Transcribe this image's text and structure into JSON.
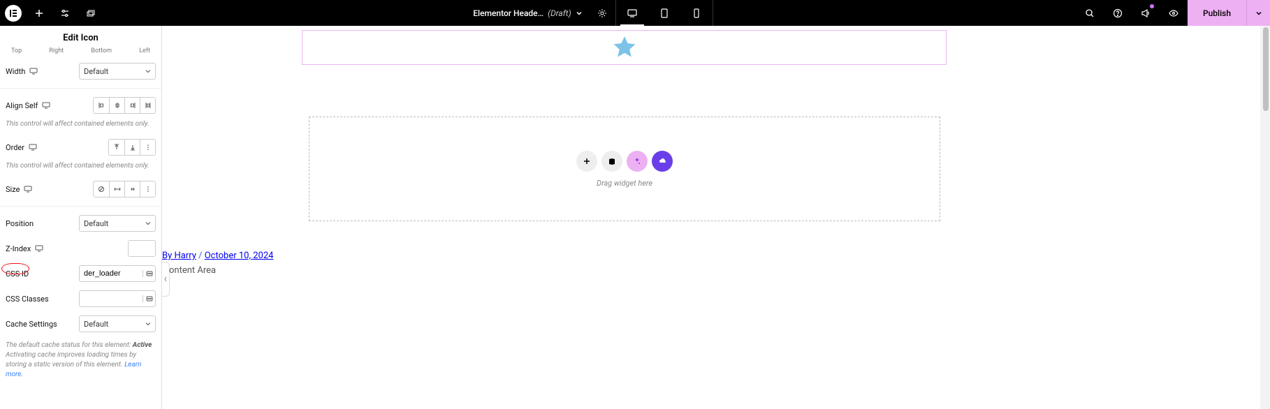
{
  "topbar": {
    "title": "Elementor Heade…",
    "status": "(Draft)",
    "publish_label": "Publish"
  },
  "panel": {
    "title": "Edit Icon",
    "tiny": {
      "top": "Top",
      "right": "Right",
      "bottom": "Bottom",
      "left": "Left"
    },
    "width_label": "Width",
    "width_value": "Default",
    "align_self_label": "Align Self",
    "hint1": "This control will affect contained elements only.",
    "order_label": "Order",
    "hint2": "This control will affect contained elements only.",
    "size_label": "Size",
    "position_label": "Position",
    "position_value": "Default",
    "zindex_label": "Z-Index",
    "cssid_label": "CSS ID",
    "cssid_value": "der_loader",
    "cssclasses_label": "CSS Classes",
    "cache_label": "Cache Settings",
    "cache_value": "Default",
    "cache_note_prefix": "The default cache status for this element: ",
    "cache_note_bold": "Active",
    "cache_note_rest": "Activating cache improves loading times by storing a static version of this element. ",
    "cache_note_link": "Learn more."
  },
  "canvas": {
    "drag_text": "Drag widget here",
    "meta_by": "By Harry",
    "meta_sep": " / ",
    "meta_date": "October 10, 2024",
    "content_area": "ontent Area"
  }
}
